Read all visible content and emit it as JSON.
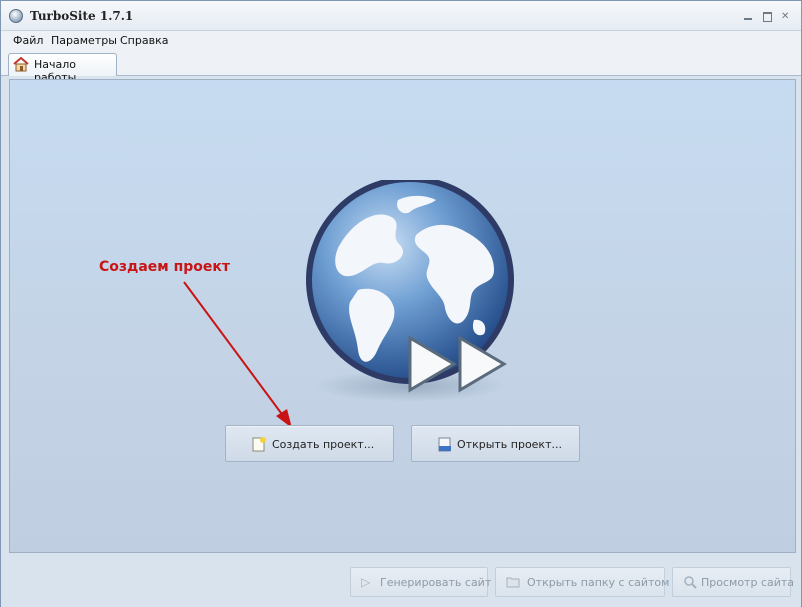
{
  "window": {
    "title": "TurboSite 1.7.1",
    "controls": [
      "minimize-icon",
      "maximize-icon",
      "close-icon"
    ]
  },
  "menu": {
    "items": [
      {
        "label": "Файл"
      },
      {
        "label": "Параметры"
      },
      {
        "label": "Справка"
      }
    ]
  },
  "tabs": [
    {
      "label": "Начало работы",
      "icon": "home-icon",
      "active": true
    }
  ],
  "start_page": {
    "annotation": "Создаем проект",
    "annotation_color": "#c81414",
    "create_label": "Создать проект...",
    "open_label": "Открыть проект..."
  },
  "footer": {
    "generate_label": "Генерировать сайт",
    "open_folder_label": "Открыть папку с сайтом",
    "preview_label": "Просмотр сайта",
    "enabled": false
  },
  "colors": {
    "content_bg": "#c6dbf1",
    "accent_red": "#c81414"
  }
}
